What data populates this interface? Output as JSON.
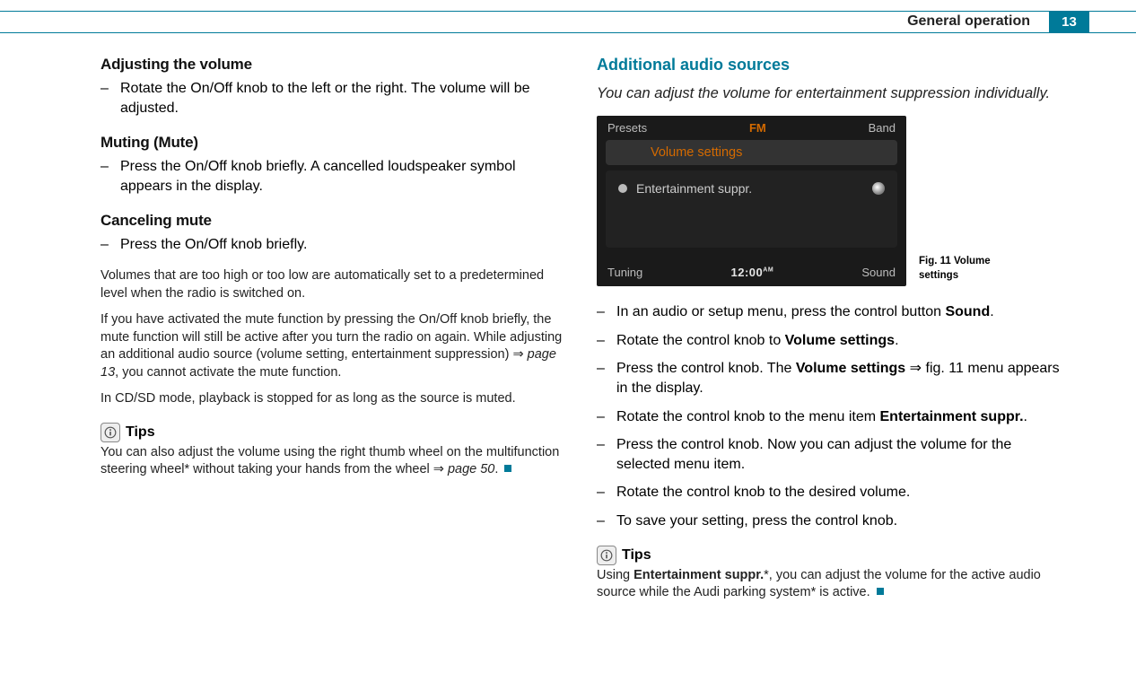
{
  "header": {
    "section_title": "General operation",
    "page_number": "13"
  },
  "left": {
    "h1": "Adjusting the volume",
    "h1_item": "Rotate the On/Off knob to the left or the right. The volume will be adjusted.",
    "h2": "Muting (Mute)",
    "h2_item": "Press the On/Off knob briefly. A cancelled loudspeaker symbol appears in the display.",
    "h3": "Canceling mute",
    "h3_item": "Press the On/Off knob briefly.",
    "p1": "Volumes that are too high or too low are automatically set to a predetermined level when the radio is switched on.",
    "p2a": "If you have activated the mute function by pressing the On/Off knob briefly, the mute function will still be active after you turn the radio on again. While adjusting an additional audio source (volume setting, entertainment suppression) ",
    "p2_ref": "page 13",
    "p2b": ", you cannot activate the mute function.",
    "p3": "In CD/SD mode, playback is stopped for as long as the source is muted.",
    "tips_label": "Tips",
    "tips_a": "You can also adjust the volume using the right thumb wheel on the multifunction steering wheel* without taking your hands from the wheel ",
    "tips_ref": "page 50",
    "tips_b": "."
  },
  "right": {
    "section_heading": "Additional audio sources",
    "intro": "You can adjust the volume for entertainment suppression individually.",
    "mmi": {
      "presets": "Presets",
      "fm": "FM",
      "band": "Band",
      "volume_settings": "Volume settings",
      "entertainment": "Entertainment suppr.",
      "tuning": "Tuning",
      "time": "12:00",
      "ampm": "AM",
      "sound": "Sound"
    },
    "fig_caption": "Fig. 11   Volume settings",
    "s1a": "In an audio or setup menu, press the control button ",
    "s1b": "Sound",
    "s1c": ".",
    "s2a": "Rotate the control knob to ",
    "s2b": "Volume settings",
    "s2c": ".",
    "s3a": "Press the control knob. The ",
    "s3b": "Volume settings",
    "s3c": " ⇒ fig. 11 menu appears in the display.",
    "s4a": "Rotate the control knob to the menu item ",
    "s4b": "Entertainment suppr.",
    "s4c": ".",
    "s5": "Press the control knob. Now you can adjust the volume for the selected menu item.",
    "s6": "Rotate the control knob to the desired volume.",
    "s7": "To save your setting, press the control knob.",
    "tips_label": "Tips",
    "tips_a": "Using ",
    "tips_b": "Entertainment suppr.",
    "tips_c": "*, you can adjust the volume for the active audio source while the Audi parking system* is active."
  }
}
